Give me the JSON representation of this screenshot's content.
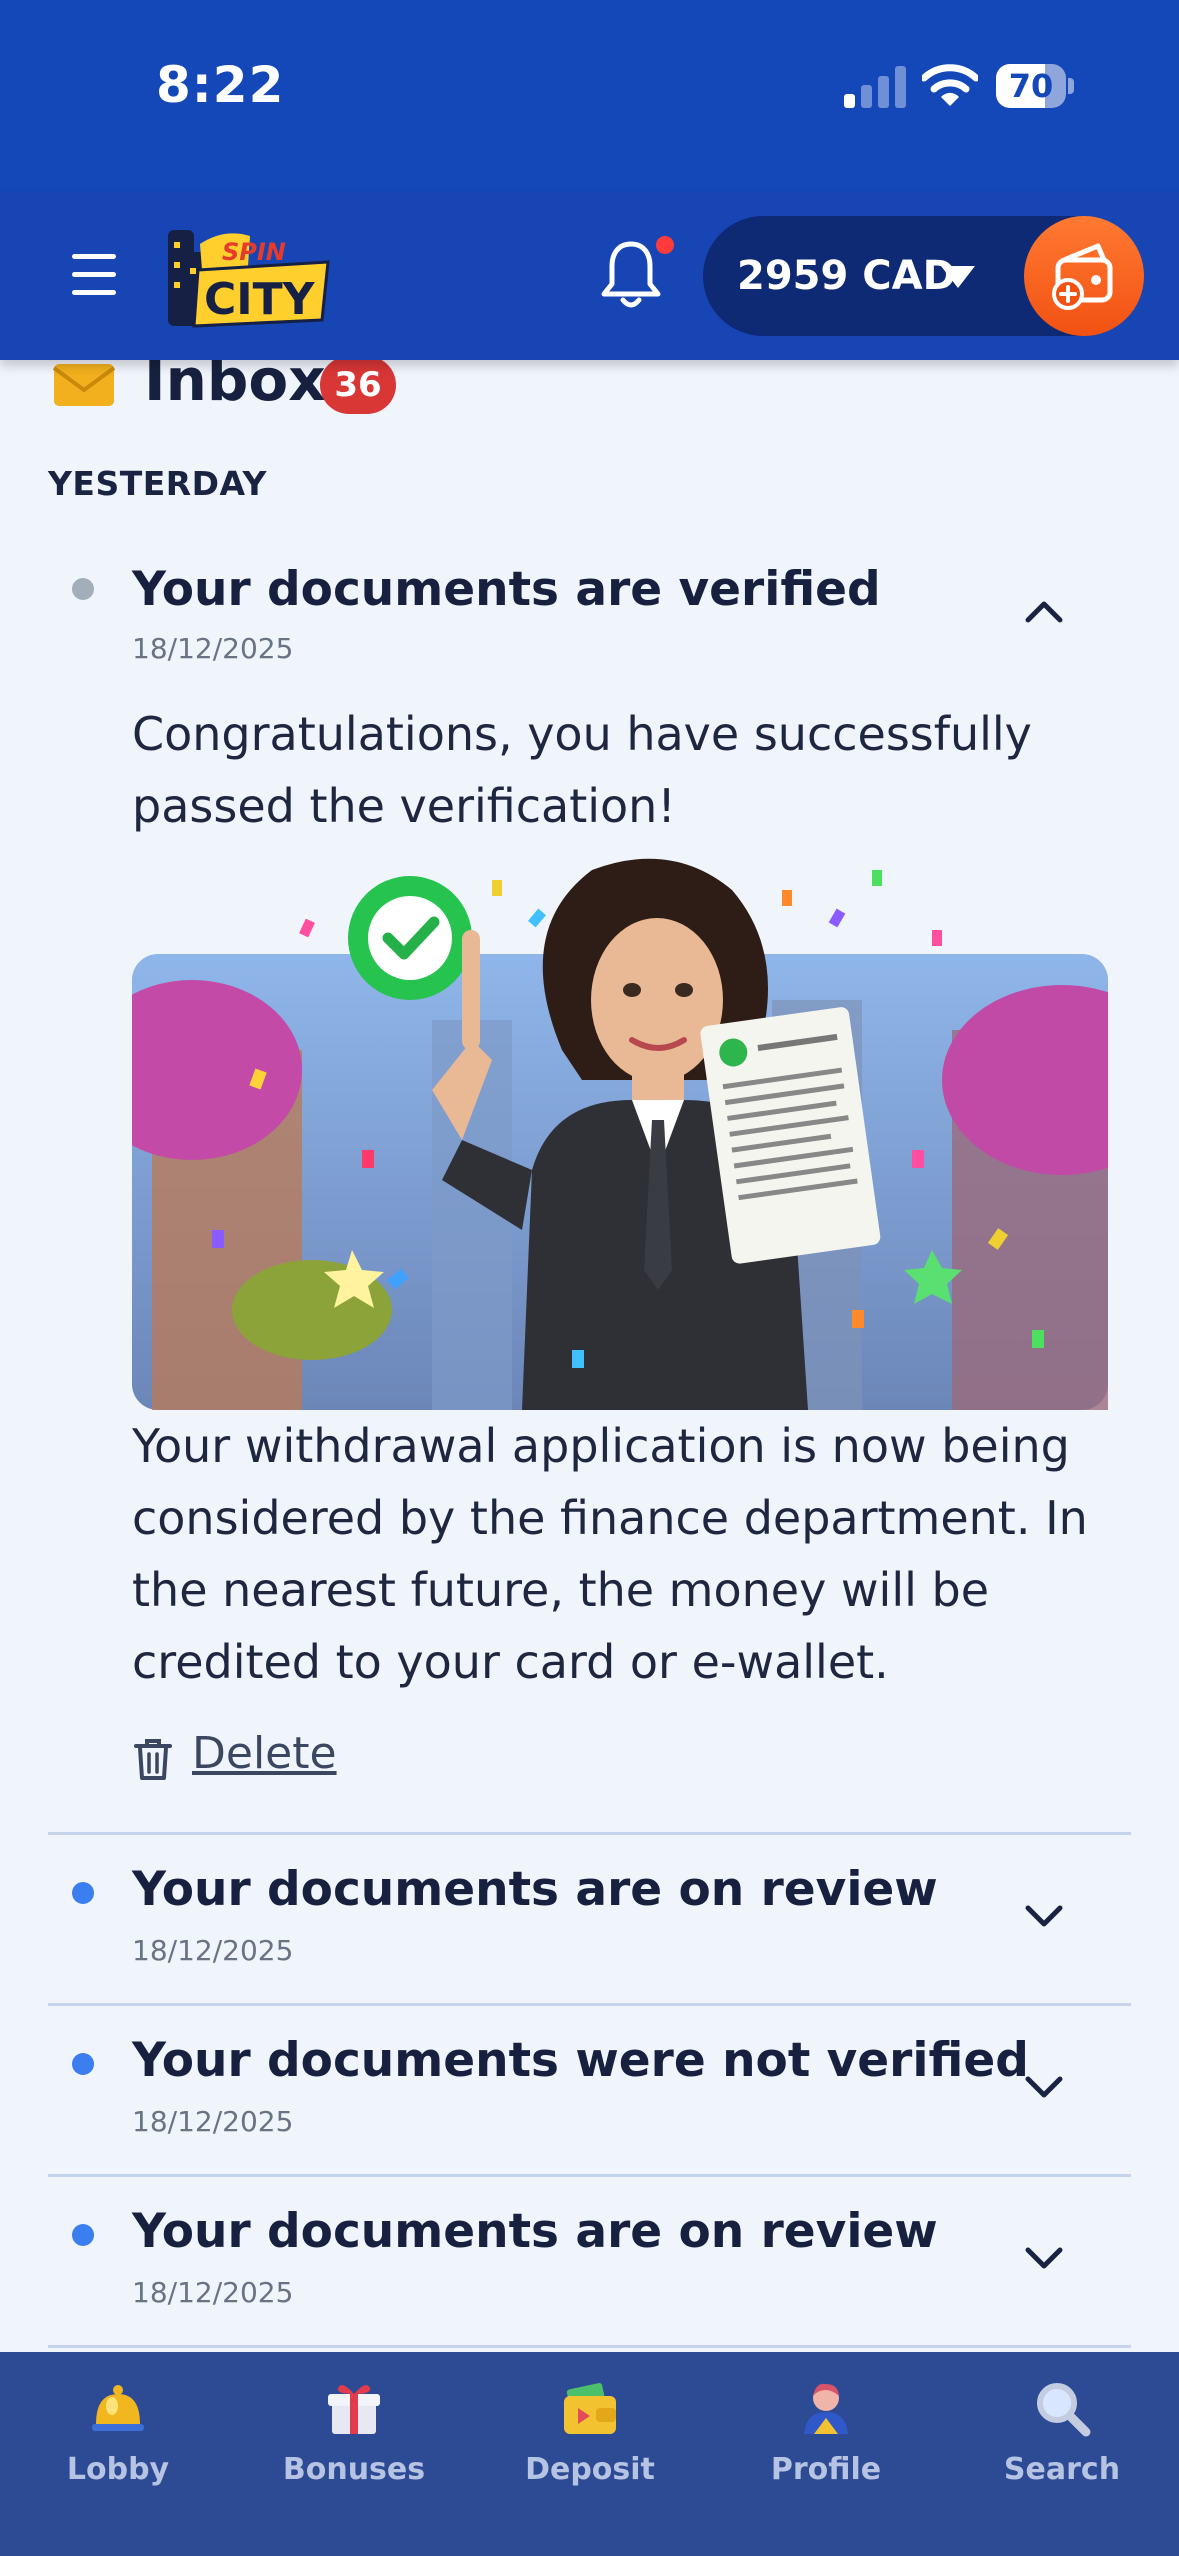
{
  "status_bar": {
    "time": "8:22",
    "battery": "70",
    "battery_level": 0.7
  },
  "header": {
    "logo_text_top": "SPIN",
    "logo_text_bottom": "CITY",
    "balance": "2959 CAD",
    "icons": [
      "menu-icon",
      "bell-icon",
      "caret-down-icon",
      "deposit-wallet-icon"
    ]
  },
  "inbox": {
    "title": "Inbox",
    "count": "36",
    "section_label": "YESTERDAY",
    "messages": [
      {
        "title": "Your documents are verified",
        "date": "18/12/2025",
        "state": "read",
        "expanded": true,
        "intro": "Congratulations, you have successfully passed the verification!",
        "body": "Your withdrawal application is now being considered by the finance department. In the nearest future, the money will be credited to your card or e-wallet.",
        "delete_label": "Delete"
      },
      {
        "title": "Your documents are on review",
        "date": "18/12/2025",
        "state": "unread",
        "expanded": false
      },
      {
        "title": "Your documents were not verified",
        "date": "18/12/2025",
        "state": "unread",
        "expanded": false
      },
      {
        "title": "Your documents are on review",
        "date": "18/12/2025",
        "state": "unread",
        "expanded": false
      }
    ]
  },
  "bottom_nav": {
    "items": [
      {
        "label": "Lobby",
        "icon": "service-bell-icon"
      },
      {
        "label": "Bonuses",
        "icon": "gift-icon"
      },
      {
        "label": "Deposit",
        "icon": "wallet-icon"
      },
      {
        "label": "Profile",
        "icon": "profile-icon"
      },
      {
        "label": "Search",
        "icon": "search-icon"
      }
    ]
  },
  "colors": {
    "primary": "#1745b4",
    "nav_bg": "#2d4b94",
    "accent_orange": "#f25112",
    "badge_red": "#d93636",
    "unread_dot": "#3b7ef0",
    "read_dot": "#a4adba"
  }
}
